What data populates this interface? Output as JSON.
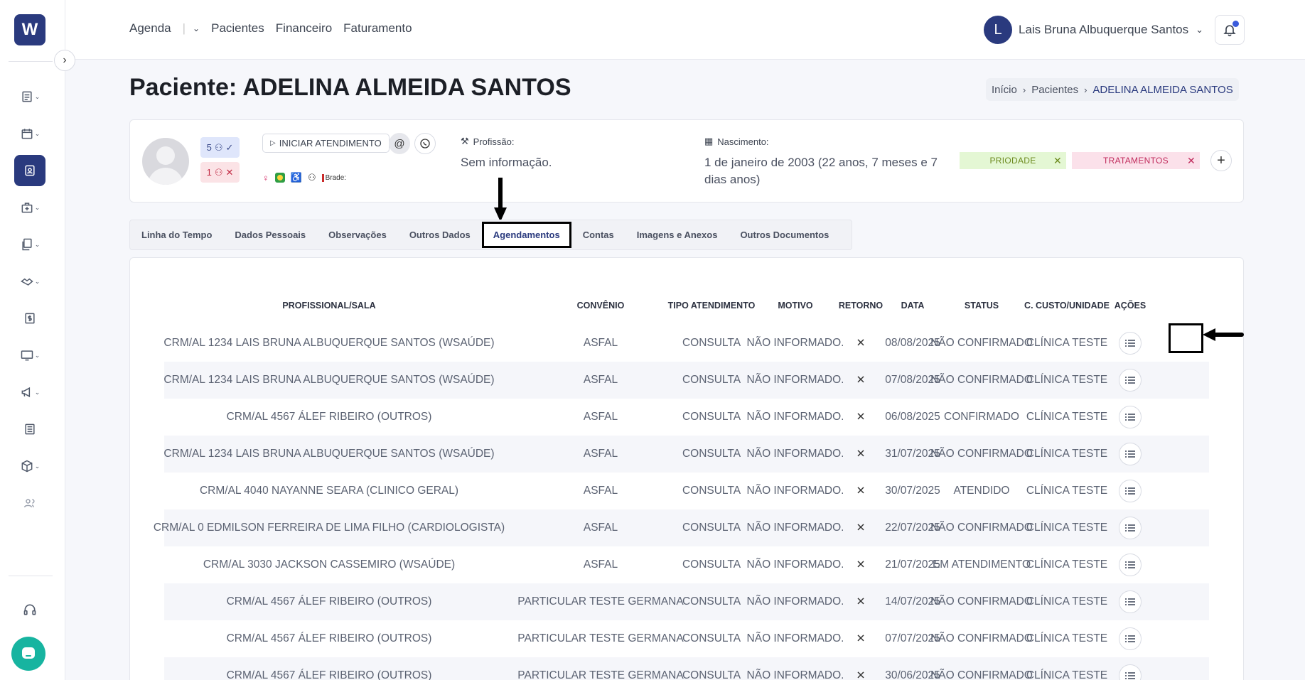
{
  "sidebar": {
    "logo": "W",
    "items": [
      {
        "icon": "list-icon",
        "chevron": "⌄"
      },
      {
        "icon": "calendar-icon",
        "chevron": "⌄"
      },
      {
        "icon": "patient-card-icon",
        "chevron": "",
        "active": true
      },
      {
        "icon": "clinic-icon",
        "chevron": "⌄"
      },
      {
        "icon": "documents-icon",
        "chevron": "⌄"
      },
      {
        "icon": "handshake-icon",
        "chevron": "⌄"
      },
      {
        "icon": "dollar-icon",
        "chevron": ""
      },
      {
        "icon": "monitor-icon",
        "chevron": "⌄"
      },
      {
        "icon": "megaphone-icon",
        "chevron": "⌄"
      },
      {
        "icon": "report-icon",
        "chevron": ""
      },
      {
        "icon": "package-icon",
        "chevron": "⌄"
      },
      {
        "icon": "users-icon",
        "chevron": ""
      }
    ],
    "support_icon": "headset-icon",
    "chat_icon": "chat-icon"
  },
  "topnav": {
    "agenda": "Agenda",
    "pacientes": "Pacientes",
    "financeiro": "Financeiro",
    "faturamento": "Faturamento"
  },
  "user": {
    "initial": "L",
    "name": "Lais Bruna Albuquerque Santos"
  },
  "page": {
    "title": "Paciente: ADELINA ALMEIDA SANTOS",
    "breadcrumb": [
      "Início",
      "Pacientes",
      "ADELINA ALMEIDA SANTOS"
    ]
  },
  "patient": {
    "badge_ok": "5",
    "badge_err": "1",
    "start_button": "INICIAR ATENDIMENTO",
    "insurance_short": "Brade:",
    "profissao_label": "Profissão:",
    "profissao_value": "Sem informação.",
    "nascimento_label": "Nascimento:",
    "nascimento_value": "1 de janeiro de 2003 (22 anos, 7 meses e 7 dias anos)",
    "tags": [
      "PRIODADE",
      "TRATAMENTOS"
    ]
  },
  "tabs": [
    "Linha do Tempo",
    "Dados Pessoais",
    "Observações",
    "Outros Dados",
    "Agendamentos",
    "Contas",
    "Imagens e Anexos",
    "Outros Documentos"
  ],
  "active_tab": "Agendamentos",
  "table": {
    "headers": [
      "PROFISSIONAL/SALA",
      "CONVÊNIO",
      "TIPO ATENDIMENTO",
      "MOTIVO",
      "RETORNO",
      "DATA",
      "STATUS",
      "C. CUSTO/UNIDADE",
      "AÇÕES"
    ],
    "rows": [
      [
        "CRM/AL 1234 LAIS BRUNA ALBUQUERQUE SANTOS (WSAÚDE)",
        "ASFAL",
        "CONSULTA",
        "NÃO INFORMADO.",
        "✕",
        "08/08/2025",
        "NÃO CONFIRMADO",
        "CLÍNICA TESTE"
      ],
      [
        "CRM/AL 1234 LAIS BRUNA ALBUQUERQUE SANTOS (WSAÚDE)",
        "ASFAL",
        "CONSULTA",
        "NÃO INFORMADO.",
        "✕",
        "07/08/2025",
        "NÃO CONFIRMADO",
        "CLÍNICA TESTE"
      ],
      [
        "CRM/AL 4567 ÁLEF RIBEIRO (OUTROS)",
        "ASFAL",
        "CONSULTA",
        "NÃO INFORMADO.",
        "✕",
        "06/08/2025",
        "CONFIRMADO",
        "CLÍNICA TESTE"
      ],
      [
        "CRM/AL 1234 LAIS BRUNA ALBUQUERQUE SANTOS (WSAÚDE)",
        "ASFAL",
        "CONSULTA",
        "NÃO INFORMADO.",
        "✕",
        "31/07/2025",
        "NÃO CONFIRMADO",
        "CLÍNICA TESTE"
      ],
      [
        "CRM/AL 4040 NAYANNE SEARA (CLINICO GERAL)",
        "ASFAL",
        "CONSULTA",
        "NÃO INFORMADO.",
        "✕",
        "30/07/2025",
        "ATENDIDO",
        "CLÍNICA TESTE"
      ],
      [
        "CRM/AL 0 EDMILSON FERREIRA DE LIMA FILHO (CARDIOLOGISTA)",
        "ASFAL",
        "CONSULTA",
        "NÃO INFORMADO.",
        "✕",
        "22/07/2025",
        "NÃO CONFIRMADO",
        "CLÍNICA TESTE"
      ],
      [
        "CRM/AL 3030 JACKSON CASSEMIRO (WSAÚDE)",
        "ASFAL",
        "CONSULTA",
        "NÃO INFORMADO.",
        "✕",
        "21/07/2025",
        "EM ATENDIMENTO",
        "CLÍNICA TESTE"
      ],
      [
        "CRM/AL 4567 ÁLEF RIBEIRO (OUTROS)",
        "PARTICULAR TESTE GERMANA",
        "CONSULTA",
        "NÃO INFORMADO.",
        "✕",
        "14/07/2025",
        "NÃO CONFIRMADO",
        "CLÍNICA TESTE"
      ],
      [
        "CRM/AL 4567 ÁLEF RIBEIRO (OUTROS)",
        "PARTICULAR TESTE GERMANA",
        "CONSULTA",
        "NÃO INFORMADO.",
        "✕",
        "07/07/2025",
        "NÃO CONFIRMADO",
        "CLÍNICA TESTE"
      ],
      [
        "CRM/AL 4567 ÁLEF RIBEIRO (OUTROS)",
        "PARTICULAR TESTE GERMANA",
        "CONSULTA",
        "NÃO INFORMADO.",
        "✕",
        "30/06/2025",
        "NÃO CONFIRMADO",
        "CLÍNICA TESTE"
      ]
    ]
  },
  "colors": {
    "primary": "#2a3a7e",
    "teal": "#17b4a0",
    "alt_row": "#f5f6fa"
  }
}
